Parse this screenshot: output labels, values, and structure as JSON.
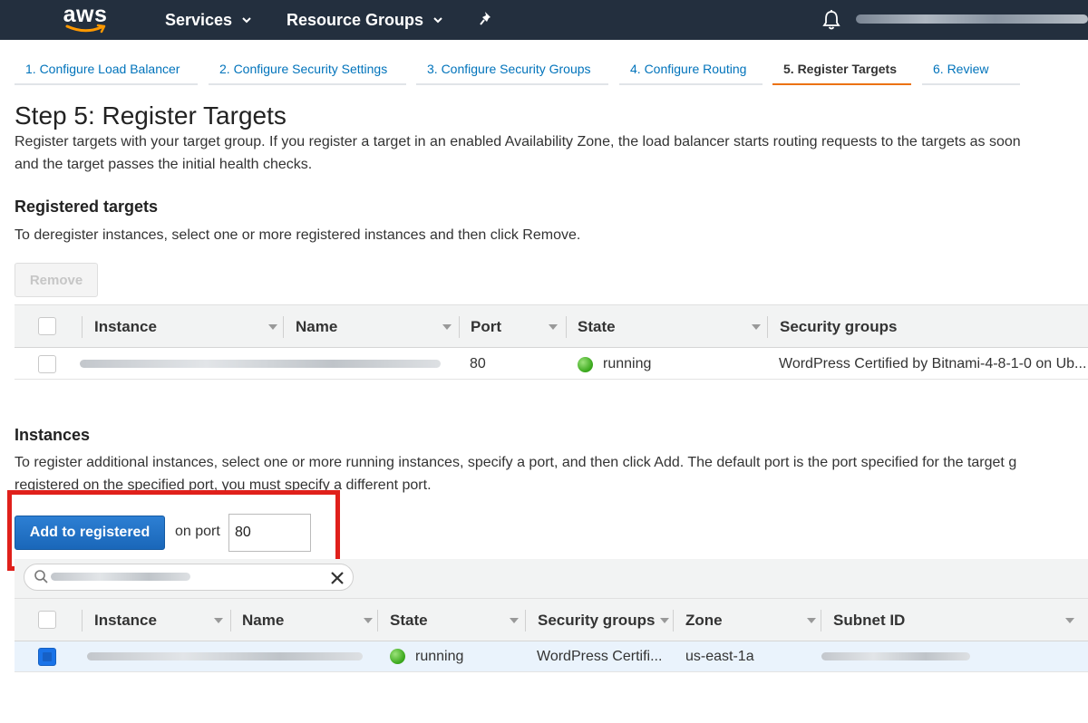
{
  "nav": {
    "logo": "aws",
    "services": "Services",
    "resource_groups": "Resource Groups"
  },
  "tabs": [
    {
      "label": "1. Configure Load Balancer"
    },
    {
      "label": "2. Configure Security Settings"
    },
    {
      "label": "3. Configure Security Groups"
    },
    {
      "label": "4. Configure Routing"
    },
    {
      "label": "5. Register Targets",
      "active": true
    },
    {
      "label": "6. Review"
    }
  ],
  "page": {
    "title": "Step 5: Register Targets",
    "intro_line1": "Register targets with your target group. If you register a target in an enabled Availability Zone, the load balancer starts routing requests to the targets as soon",
    "intro_line2": "and the target passes the initial health checks."
  },
  "registered": {
    "title": "Registered targets",
    "desc": "To deregister instances, select one or more registered instances and then click Remove.",
    "remove_button": "Remove",
    "columns": [
      "Instance",
      "Name",
      "Port",
      "State",
      "Security groups"
    ],
    "rows": [
      {
        "port": "80",
        "state": "running",
        "security_groups": "WordPress Certified by Bitnami-4-8-1-0 on Ub..."
      }
    ]
  },
  "instances": {
    "title": "Instances",
    "desc_line1": "To register additional instances, select one or more running instances, specify a port, and then click Add. The default port is the port specified for the target g",
    "desc_line2": "registered on the specified port, you must specify a different port.",
    "add_button": "Add to registered",
    "on_port_label": "on port",
    "port_value": "80",
    "columns": [
      "Instance",
      "Name",
      "State",
      "Security groups",
      "Zone",
      "Subnet ID"
    ],
    "rows": [
      {
        "state": "running",
        "security_groups": "WordPress Certifi...",
        "zone": "us-east-1a",
        "selected": true
      }
    ]
  },
  "colors": {
    "nav_bg": "#232f3e",
    "link": "#0073bb",
    "active_tab": "#ec7211",
    "primary_button": "#1a67b9",
    "highlight": "#e0201b",
    "running": "#3daa1f"
  }
}
